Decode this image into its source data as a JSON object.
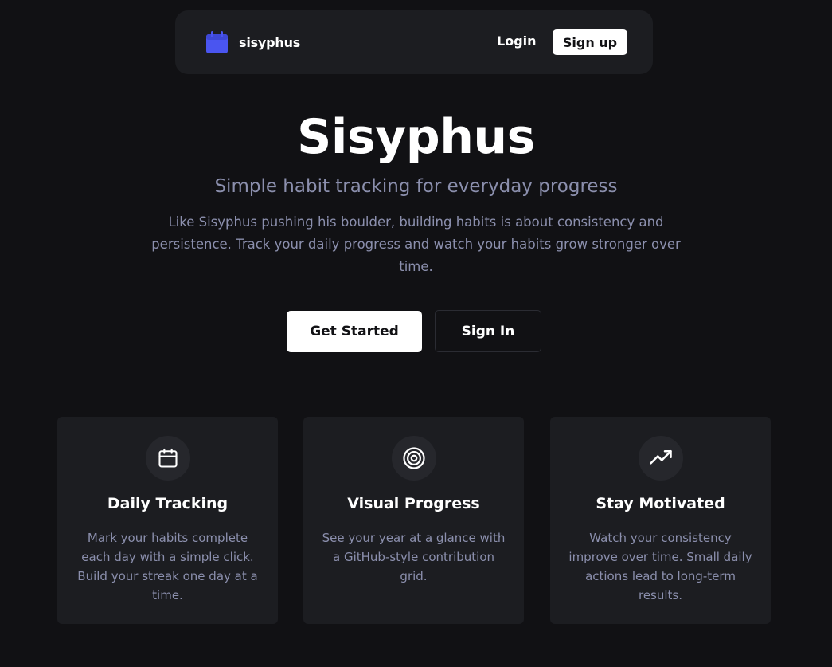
{
  "colors": {
    "background": "#111114",
    "surface": "#1c1d21",
    "accent": "#4a55f0",
    "muted_text": "#8b8fad"
  },
  "navbar": {
    "brand_icon": "calendar-icon",
    "brand_name": "sisyphus",
    "login_label": "Login",
    "signup_label": "Sign up"
  },
  "hero": {
    "title": "Sisyphus",
    "subtitle": "Simple habit tracking for everyday progress",
    "description": "Like Sisyphus pushing his boulder, building habits is about consistency and persistence. Track your daily progress and watch your habits grow stronger over time.",
    "primary_button": "Get Started",
    "secondary_button": "Sign In"
  },
  "features": [
    {
      "icon": "calendar-icon",
      "title": "Daily Tracking",
      "text": "Mark your habits complete each day with a simple click. Build your streak one day at a time."
    },
    {
      "icon": "target-icon",
      "title": "Visual Progress",
      "text": "See your year at a glance with a GitHub-style contribution grid."
    },
    {
      "icon": "trending-up-icon",
      "title": "Stay Motivated",
      "text": "Watch your consistency improve over time. Small daily actions lead to long-term results."
    }
  ]
}
